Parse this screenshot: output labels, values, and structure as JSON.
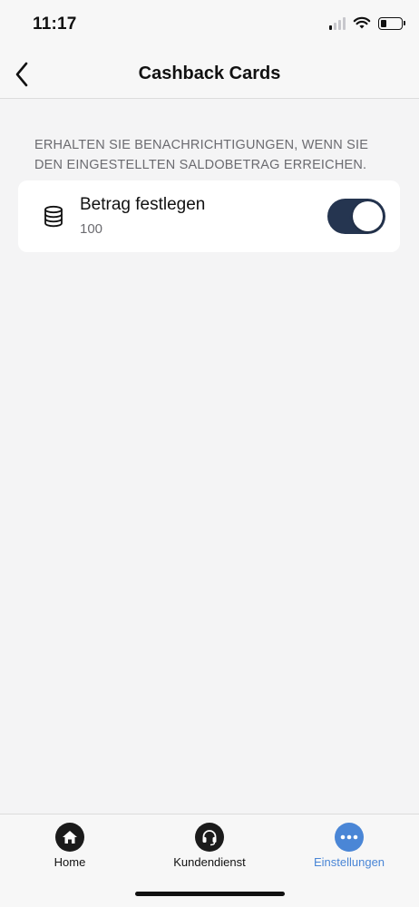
{
  "status_bar": {
    "time": "11:17"
  },
  "nav": {
    "title": "Cashback Cards",
    "back_icon": "chevron-left-icon"
  },
  "section": {
    "note": "ERHALTEN SIE BENACHRICHTIGUNGEN, WENN SIE DEN EINGESTELLTEN SALDOBETRAG ERREICHEN."
  },
  "setting": {
    "icon": "coins-stack-icon",
    "label": "Betrag festlegen",
    "value": "100",
    "toggle_on": true
  },
  "tabs": [
    {
      "label": "Home",
      "icon": "home-icon",
      "active": false
    },
    {
      "label": "Kundendienst",
      "icon": "headset-icon",
      "active": false
    },
    {
      "label": "Einstellungen",
      "icon": "more-dots-icon",
      "active": true
    }
  ],
  "colors": {
    "accent": "#4a86d6",
    "toggle_on": "#253550",
    "background": "#f4f4f5"
  }
}
